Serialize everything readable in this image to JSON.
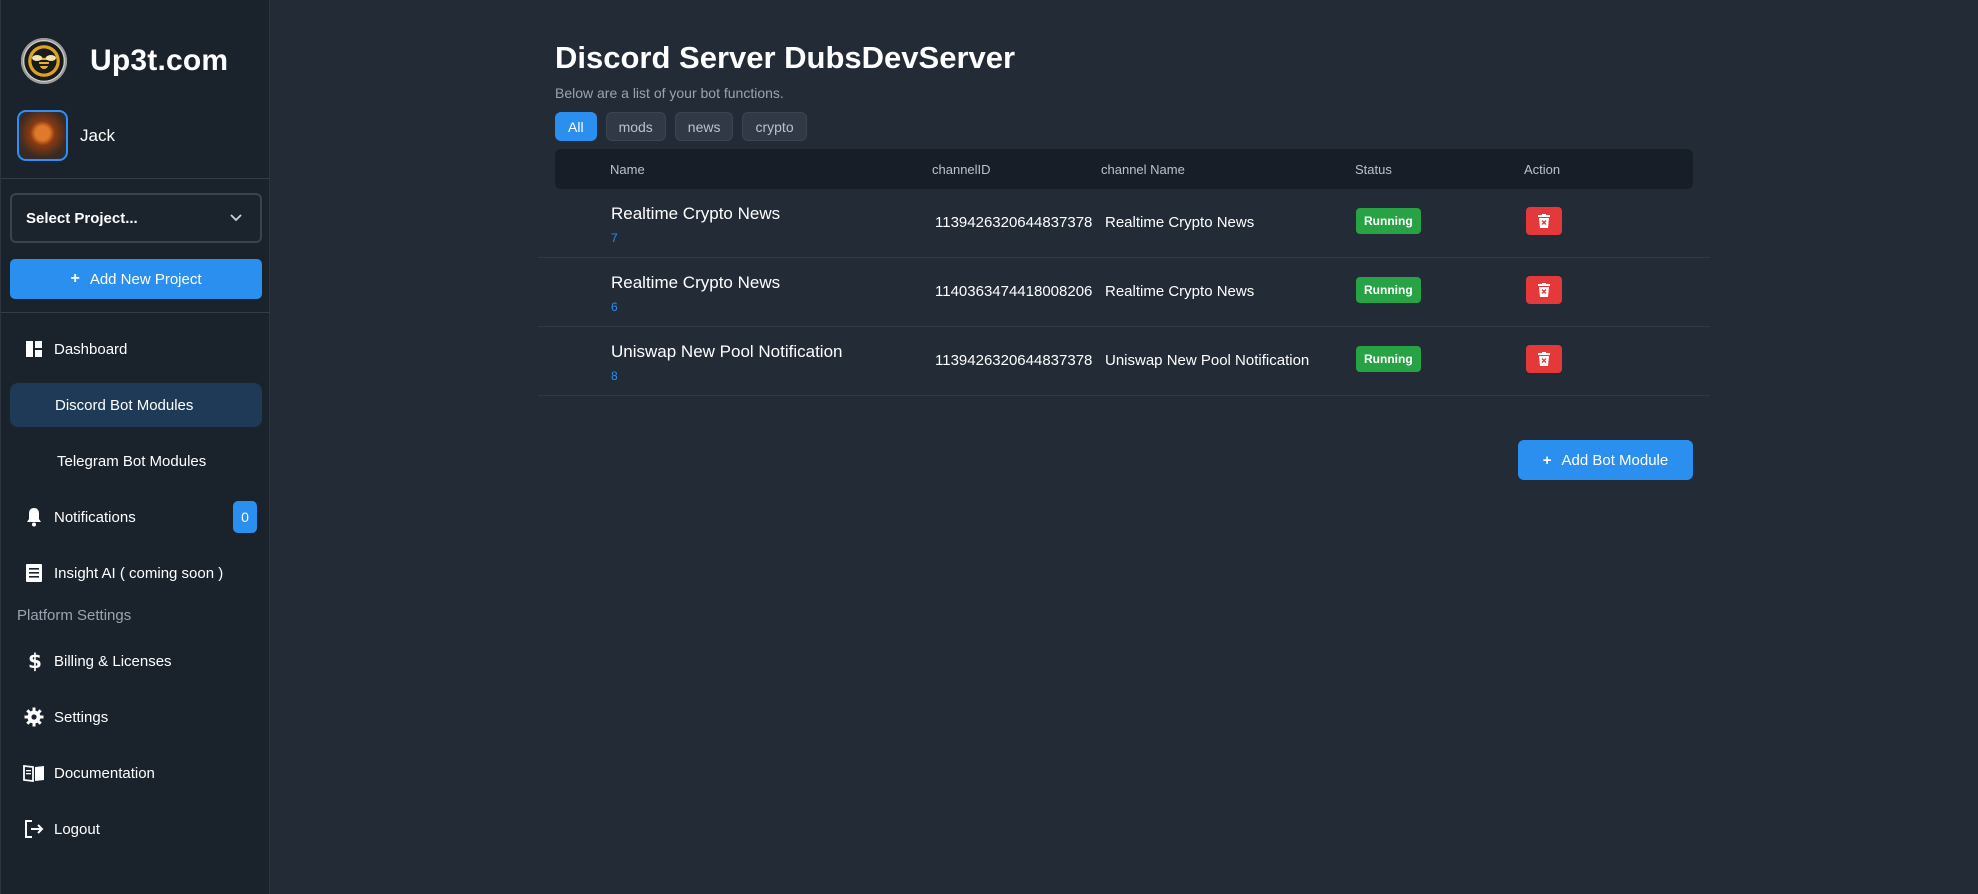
{
  "brand": {
    "name": "Up3t.com"
  },
  "user": {
    "name": "Jack"
  },
  "sidebar": {
    "project_select_label": "Select Project...",
    "add_project_label": "Add New Project",
    "items": [
      {
        "label": "Dashboard",
        "icon": "dashboard-icon"
      },
      {
        "label": "Discord Bot Modules",
        "active": true
      },
      {
        "label": "Telegram Bot Modules"
      },
      {
        "label": "Notifications",
        "icon": "bell-icon",
        "badge": "0"
      },
      {
        "label": "Insight AI ( coming soon )",
        "icon": "document-list-icon"
      }
    ],
    "section_title": "Platform Settings",
    "settings_items": [
      {
        "label": "Billing & Licenses",
        "icon": "dollar-icon"
      },
      {
        "label": "Settings",
        "icon": "gear-icon"
      },
      {
        "label": "Documentation",
        "icon": "book-icon"
      },
      {
        "label": "Logout",
        "icon": "logout-icon"
      }
    ]
  },
  "main": {
    "title": "Discord Server DubsDevServer",
    "subtitle": "Below are a list of your bot functions.",
    "filters": [
      "All",
      "mods",
      "news",
      "crypto"
    ],
    "active_filter": "All",
    "columns": [
      "Name",
      "channelID",
      "channel Name",
      "Status",
      "Action"
    ],
    "rows": [
      {
        "name": "Realtime Crypto News",
        "id": "7",
        "channel_id": "1139426320644837378",
        "channel_name": "Realtime Crypto News",
        "status": "Running"
      },
      {
        "name": "Realtime Crypto News",
        "id": "6",
        "channel_id": "1140363474418008206",
        "channel_name": "Realtime Crypto News",
        "status": "Running"
      },
      {
        "name": "Uniswap New Pool Notification",
        "id": "8",
        "channel_id": "1139426320644837378",
        "channel_name": "Uniswap New Pool Notification",
        "status": "Running"
      }
    ],
    "add_module_label": "Add Bot Module"
  },
  "colors": {
    "accent": "#2b8ff0",
    "running": "#27a244",
    "danger": "#e5383b",
    "background": "#222b36",
    "sidebar": "#1a222c"
  }
}
